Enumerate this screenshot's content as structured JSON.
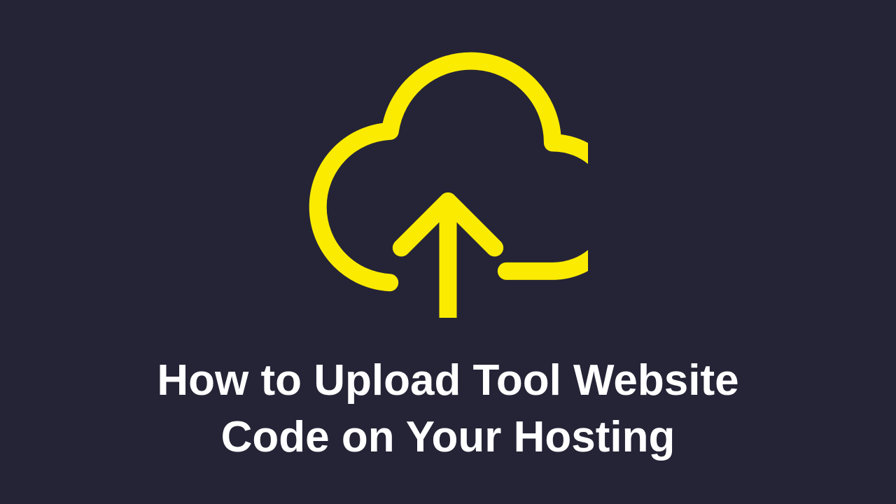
{
  "icon_name": "cloud-upload-icon",
  "title_line1": "How to Upload Tool Website",
  "title_line2": "Code on Your Hosting",
  "colors": {
    "background": "#252436",
    "icon_stroke": "#FAEB00",
    "text": "#FFFFFF"
  }
}
